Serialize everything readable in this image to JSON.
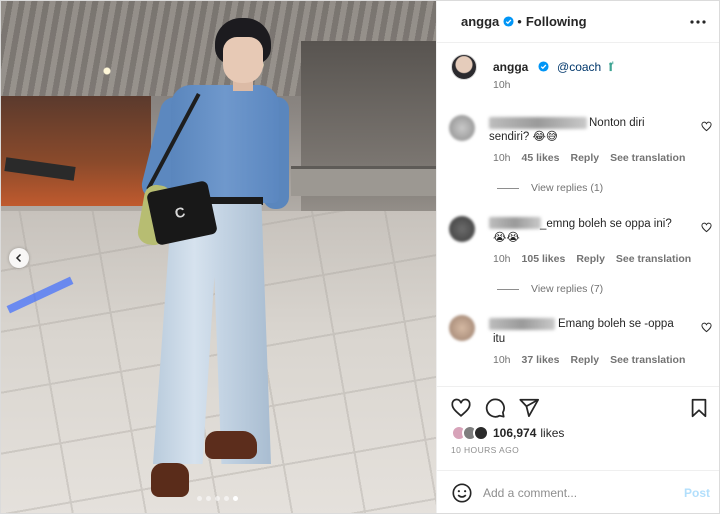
{
  "post": {
    "carousel": {
      "slides": 5,
      "active_slide": 5
    }
  },
  "header": {
    "username": "angga",
    "separator": "•",
    "follow_label": "Following"
  },
  "caption": {
    "username": "angga",
    "mention": "@coach",
    "time": "10h"
  },
  "comments": [
    {
      "text_line1": "Nonton diri",
      "text_line2": "sendiri?",
      "emoji": "😂😅",
      "time": "10h",
      "likes": "45 likes",
      "reply": "Reply",
      "translate": "See translation",
      "view_replies": "View replies (1)"
    },
    {
      "text_line1": "_emng boleh se oppa ini?",
      "emoji": "😭😭",
      "time": "10h",
      "likes": "105 likes",
      "reply": "Reply",
      "translate": "See translation",
      "view_replies": "View replies (7)"
    },
    {
      "text_line1": "Emang boleh se -oppa",
      "text_line2": "itu",
      "time": "10h",
      "likes": "37 likes",
      "reply": "Reply",
      "translate": "See translation"
    }
  ],
  "engagement": {
    "likes_count": "106,974",
    "likes_word": "likes",
    "time_ago": "10 HOURS AGO"
  },
  "comment_box": {
    "placeholder": "Add a comment...",
    "post_label": "Post"
  },
  "colors": {
    "verified": "#0095f6",
    "link": "#00376b",
    "post_disabled": "#b2dffc",
    "muted": "#737373"
  },
  "icons": [
    "verified-badge-icon",
    "more-options-icon",
    "heart-icon",
    "comment-icon",
    "share-icon",
    "bookmark-icon",
    "emoji-icon",
    "chevron-left-icon"
  ]
}
